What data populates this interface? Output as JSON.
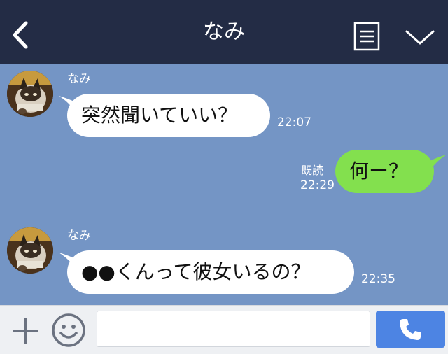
{
  "header": {
    "title": "なみ",
    "back_icon": "chevron-left-icon",
    "notes_icon": "notes-icon",
    "menu_icon": "chevron-down-icon"
  },
  "messages": [
    {
      "direction": "incoming",
      "sender": "なみ",
      "text": "突然聞いていい？",
      "time": "22:07"
    },
    {
      "direction": "outgoing",
      "text": "何ー？",
      "status": "既読",
      "time": "22:29"
    },
    {
      "direction": "incoming",
      "sender": "なみ",
      "text": "●●くんって彼女いるの？",
      "time": "22:35"
    }
  ],
  "input": {
    "value": "",
    "placeholder": ""
  },
  "icons": {
    "plus": "plus-icon",
    "emoji": "smiley-icon",
    "call": "phone-icon"
  },
  "colors": {
    "header_bg": "#232c45",
    "chat_bg": "#7495c5",
    "incoming_bubble": "#ffffff",
    "outgoing_bubble": "#83e04e",
    "call_button": "#4d84e3"
  }
}
